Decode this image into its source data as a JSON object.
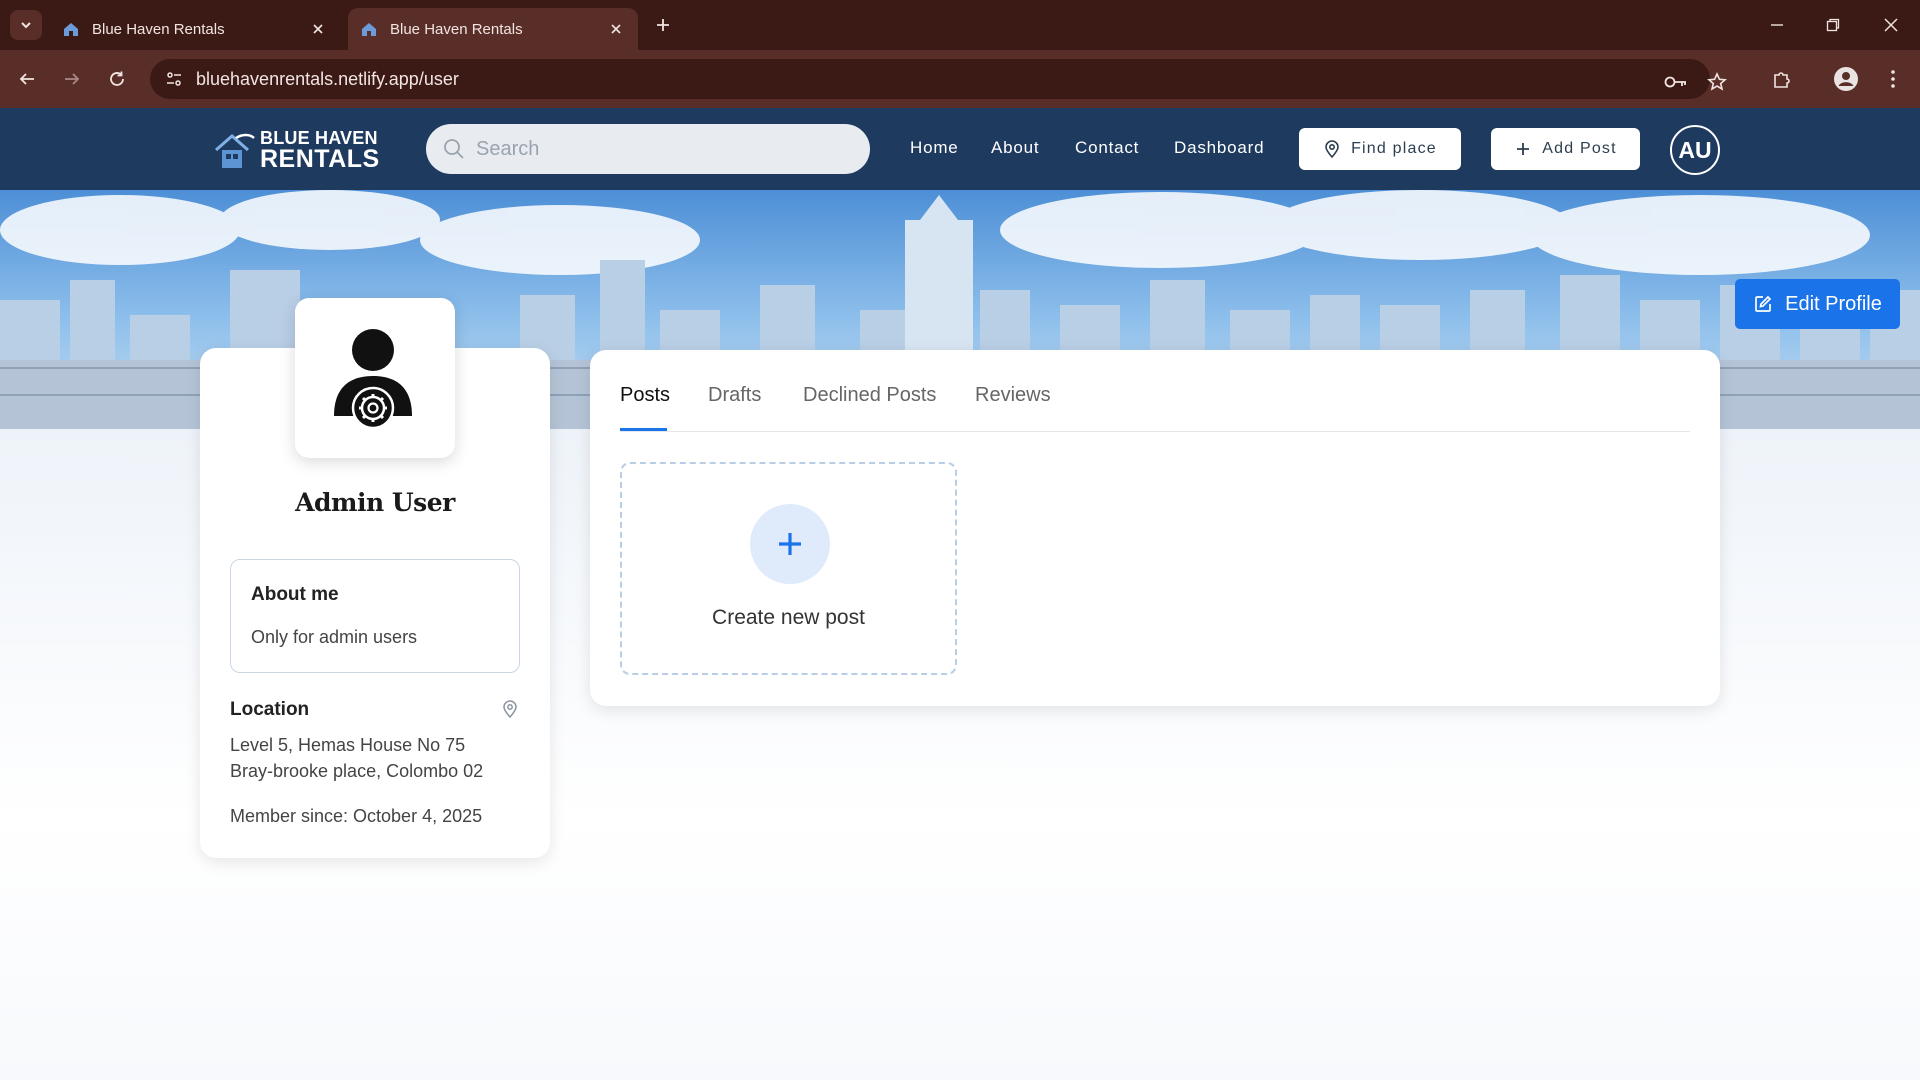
{
  "browser": {
    "tabs": [
      {
        "title": "Blue Haven Rentals",
        "active": false
      },
      {
        "title": "Blue Haven Rentals",
        "active": true
      }
    ],
    "url": "bluehavenrentals.netlify.app/user",
    "icons": {
      "tab_search": "chevron-down-icon",
      "tab_close": "close-icon",
      "new_tab": "plus-icon",
      "back": "back-arrow-icon",
      "forward": "forward-arrow-icon",
      "reload": "reload-icon",
      "site_info": "tune-icon",
      "password": "key-icon",
      "bookmark": "star-icon",
      "extensions": "puzzle-icon",
      "profile": "profile-icon",
      "menu": "kebab-menu-icon"
    }
  },
  "header": {
    "brand_top": "BLUE HAVEN",
    "brand_bottom": "RENTALS",
    "search_placeholder": "Search",
    "nav": [
      "Home",
      "About",
      "Contact",
      "Dashboard"
    ],
    "find_place_label": "Find place",
    "add_post_label": "Add Post",
    "avatar_initials": "AU"
  },
  "profile": {
    "edit_label": "Edit Profile",
    "name": "Admin User",
    "about_title": "About me",
    "about_text": "Only for admin users",
    "location_title": "Location",
    "location_line1": "Level 5, Hemas House No 75",
    "location_line2": "Bray-brooke place, Colombo 02",
    "member_since": "Member since: October 4, 2025"
  },
  "posts": {
    "tabs": [
      "Posts",
      "Drafts",
      "Declined Posts",
      "Reviews"
    ],
    "active_tab": "Posts",
    "create_label": "Create new post"
  },
  "colors": {
    "header_bg": "#1e3a5f",
    "accent": "#1a73e8",
    "browser_frame": "#3b1a16",
    "browser_toolbar": "#5a2e28"
  }
}
